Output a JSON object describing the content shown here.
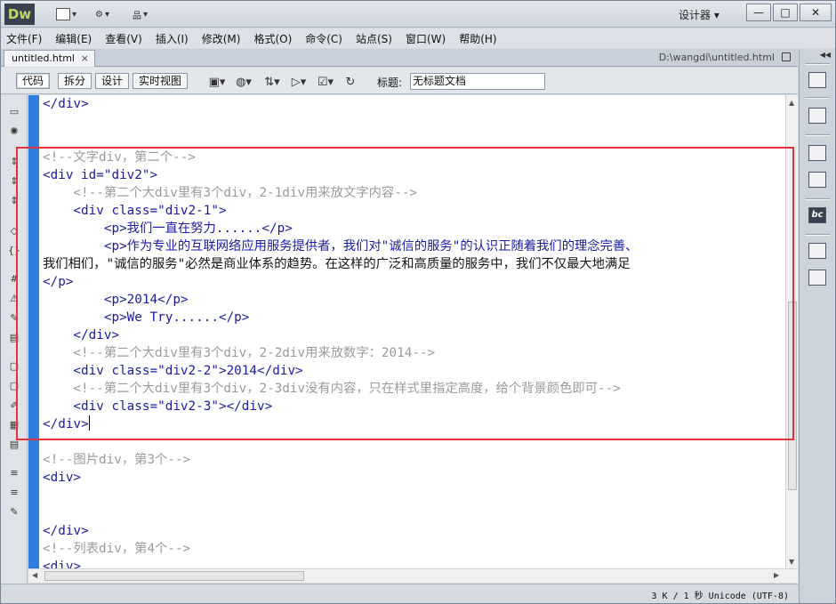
{
  "app": {
    "logo": "Dw",
    "workspace_label": "设计器",
    "window_controls": {
      "minimize": "—",
      "maximize": "□",
      "close": "✕"
    }
  },
  "menu": [
    "文件(F)",
    "编辑(E)",
    "查看(V)",
    "插入(I)",
    "修改(M)",
    "格式(O)",
    "命令(C)",
    "站点(S)",
    "窗口(W)",
    "帮助(H)"
  ],
  "document": {
    "tab_label": "untitled.html",
    "tab_close": "×",
    "path": "D:\\wangdi\\untitled.html"
  },
  "toolbar": {
    "views": [
      "代码",
      "拆分",
      "设计",
      "实时视图"
    ],
    "active_view": "代码",
    "title_label": "标题:",
    "title_value": "无标题文档"
  },
  "code_lines": [
    {
      "text": "</div>",
      "style": "tag"
    },
    {
      "text": "",
      "style": "tag"
    },
    {
      "text": "",
      "style": "tag"
    },
    {
      "text": "<!--文字div，第二个-->",
      "style": "cm"
    },
    {
      "text": "<div id=\"div2\">",
      "style": "tag"
    },
    {
      "text": "    <!--第二个大div里有3个div，2-1div用来放文字内容-->",
      "style": "cm"
    },
    {
      "text": "    <div class=\"div2-1\">",
      "style": "tag"
    },
    {
      "text": "        <p>我们一直在努力......</p>",
      "style": "mixed1"
    },
    {
      "text": "        <p>作为专业的互联网络应用服务提供者，我们对\"诚信的服务\"的认识正随着我们的理念完善、",
      "style": "mixed2"
    },
    {
      "text": "我们相们，\"诚信的服务\"必然是商业体系的趋势。在这样的广泛和高质量的服务中，我们不仅最大地满足",
      "style": "txt"
    },
    {
      "text": "</p>",
      "style": "tag"
    },
    {
      "text": "        <p>2014</p>",
      "style": "tag"
    },
    {
      "text": "        <p>We Try......</p>",
      "style": "tag"
    },
    {
      "text": "    </div>",
      "style": "tag"
    },
    {
      "text": "    <!--第二个大div里有3个div，2-2div用来放数字：2014-->",
      "style": "cm"
    },
    {
      "text": "    <div class=\"div2-2\">2014</div>",
      "style": "tag"
    },
    {
      "text": "    <!--第二个大div里有3个div，2-3div没有内容，只在样式里指定高度，给个背景颜色即可-->",
      "style": "cm"
    },
    {
      "text": "    <div class=\"div2-3\"></div>",
      "style": "tag"
    },
    {
      "text": "</div>",
      "style": "tag"
    },
    {
      "text": "",
      "style": "tag"
    },
    {
      "text": "<!--图片div，第3个-->",
      "style": "cm"
    },
    {
      "text": "<div>",
      "style": "tag"
    },
    {
      "text": "",
      "style": "tag"
    },
    {
      "text": "",
      "style": "tag"
    },
    {
      "text": "</div>",
      "style": "tag"
    },
    {
      "text": "<!--列表div，第4个-->",
      "style": "cm"
    },
    {
      "text": "<div>",
      "style": "tag"
    }
  ],
  "status": {
    "text": "3 K / 1 秒 Unicode (UTF-8)"
  },
  "colors": {
    "gutter": "#2f7de1",
    "highlight": "#e8313a",
    "tag": "#0c0ca6",
    "comment": "#9a9a9a"
  }
}
